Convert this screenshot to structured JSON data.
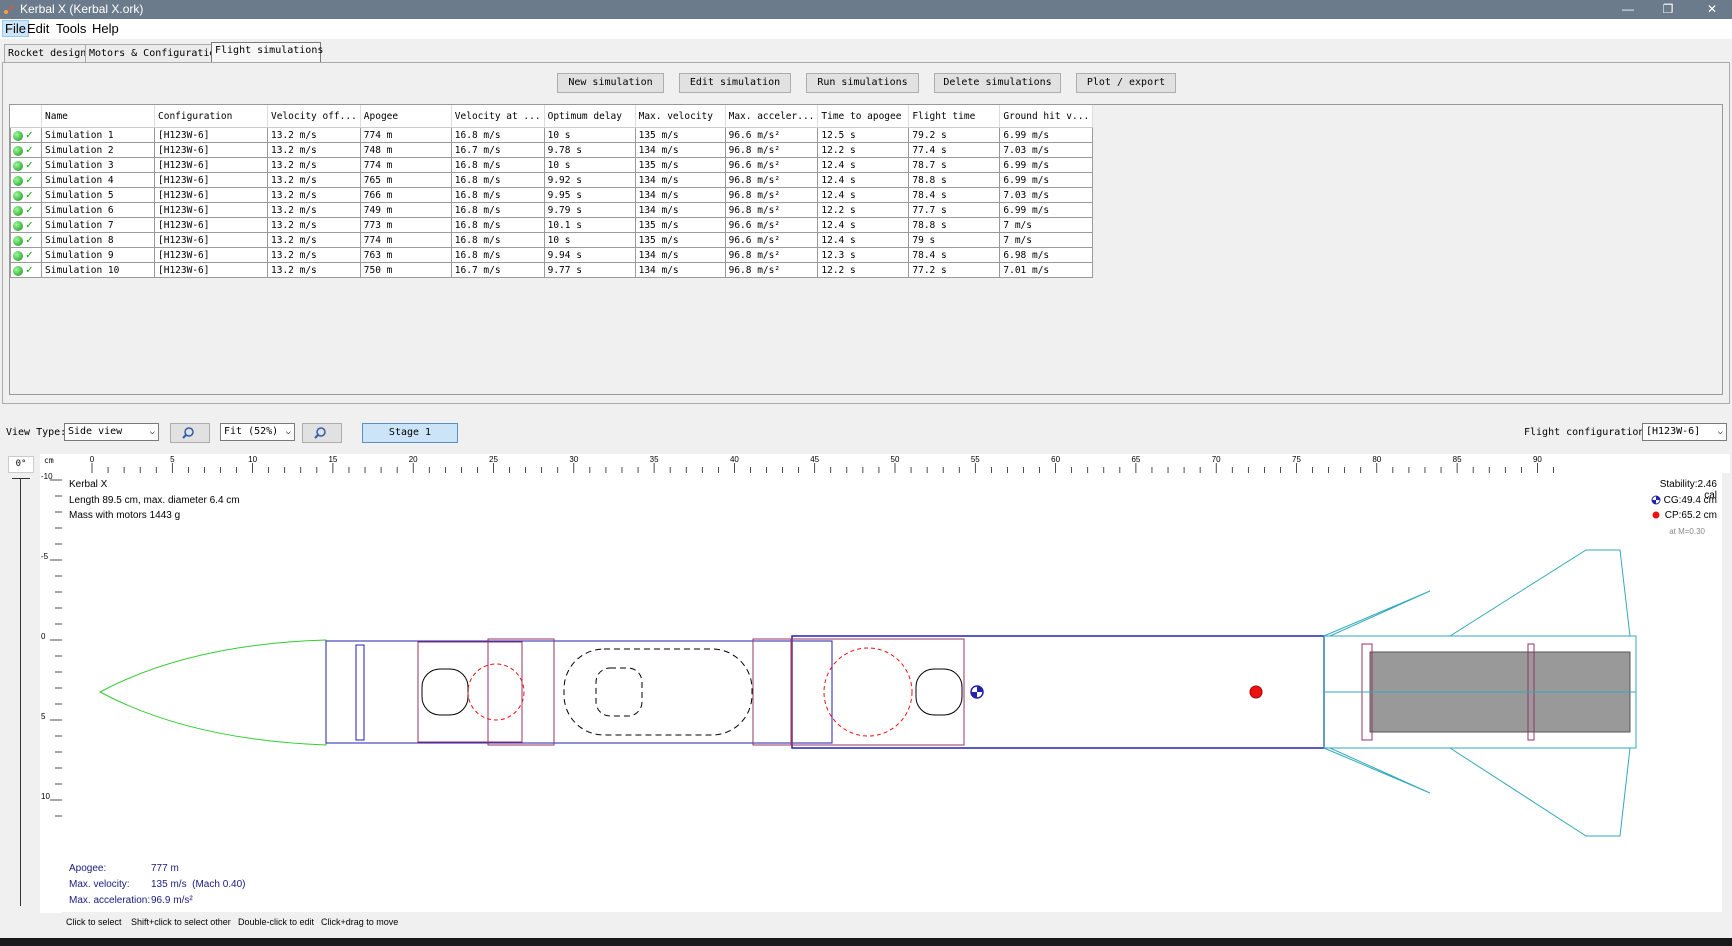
{
  "window": {
    "title": "Kerbal X (Kerbal X.ork)",
    "minimize": "—",
    "restore": "❐",
    "close": "✕"
  },
  "menu": {
    "file": "File",
    "edit": "Edit",
    "tools": "Tools",
    "help": "Help"
  },
  "tabs": {
    "rocket_design": "Rocket design",
    "motors": "Motors & Configuration",
    "flight_sims": "Flight simulations"
  },
  "buttons": {
    "new": "New simulation",
    "edit": "Edit simulation",
    "run": "Run simulations",
    "delete": "Delete simulations",
    "plot": "Plot / export"
  },
  "table": {
    "headers": [
      "Name",
      "Configuration",
      "Velocity off...",
      "Apogee",
      "Velocity at ...",
      "Optimum delay",
      "Max. velocity",
      "Max. acceler...",
      "Time to apogee",
      "Flight time",
      "Ground hit v..."
    ],
    "rows": [
      [
        "Simulation 1",
        "[H123W-6]",
        "13.2 m/s",
        "774 m",
        "16.8 m/s",
        "10 s",
        "135 m/s",
        "96.6 m/s²",
        "12.5 s",
        "79.2 s",
        "6.99 m/s"
      ],
      [
        "Simulation 2",
        "[H123W-6]",
        "13.2 m/s",
        "748 m",
        "16.7 m/s",
        "9.78 s",
        "134 m/s",
        "96.8 m/s²",
        "12.2 s",
        "77.4 s",
        "7.03 m/s"
      ],
      [
        "Simulation 3",
        "[H123W-6]",
        "13.2 m/s",
        "774 m",
        "16.8 m/s",
        "10 s",
        "135 m/s",
        "96.6 m/s²",
        "12.4 s",
        "78.7 s",
        "6.99 m/s"
      ],
      [
        "Simulation 4",
        "[H123W-6]",
        "13.2 m/s",
        "765 m",
        "16.8 m/s",
        "9.92 s",
        "134 m/s",
        "96.8 m/s²",
        "12.4 s",
        "78.8 s",
        "6.99 m/s"
      ],
      [
        "Simulation 5",
        "[H123W-6]",
        "13.2 m/s",
        "766 m",
        "16.8 m/s",
        "9.95 s",
        "134 m/s",
        "96.8 m/s²",
        "12.4 s",
        "78.4 s",
        "7.03 m/s"
      ],
      [
        "Simulation 6",
        "[H123W-6]",
        "13.2 m/s",
        "749 m",
        "16.8 m/s",
        "9.79 s",
        "134 m/s",
        "96.8 m/s²",
        "12.2 s",
        "77.7 s",
        "6.99 m/s"
      ],
      [
        "Simulation 7",
        "[H123W-6]",
        "13.2 m/s",
        "773 m",
        "16.8 m/s",
        "10.1 s",
        "135 m/s",
        "96.6 m/s²",
        "12.4 s",
        "78.8 s",
        "7 m/s"
      ],
      [
        "Simulation 8",
        "[H123W-6]",
        "13.2 m/s",
        "774 m",
        "16.8 m/s",
        "10 s",
        "135 m/s",
        "96.6 m/s²",
        "12.4 s",
        "79 s",
        "7 m/s"
      ],
      [
        "Simulation 9",
        "[H123W-6]",
        "13.2 m/s",
        "763 m",
        "16.8 m/s",
        "9.94 s",
        "134 m/s",
        "96.8 m/s²",
        "12.3 s",
        "78.4 s",
        "6.98 m/s"
      ],
      [
        "Simulation 10",
        "[H123W-6]",
        "13.2 m/s",
        "750 m",
        "16.7 m/s",
        "9.77 s",
        "134 m/s",
        "96.8 m/s²",
        "12.2 s",
        "77.2 s",
        "7.01 m/s"
      ]
    ]
  },
  "view": {
    "view_type_label": "View Type:",
    "view_type": "Side view",
    "zoom": "Fit (52%)",
    "stage": "Stage 1",
    "flight_config_label": "Flight configuration:",
    "flight_config": "[H123W-6]"
  },
  "figure": {
    "rotation": "0°",
    "unit": "cm",
    "rocket_name": "Kerbal X",
    "dims": "Length 89.5 cm, max. diameter 6.4 cm",
    "mass": "Mass with motors 1443 g",
    "stability": "Stability:2.46 cal",
    "cg": "CG:49.4 cm",
    "cp": "CP:65.2 cm",
    "mach": "at M=0.30",
    "apogee_label": "Apogee:",
    "apogee": "777 m",
    "maxv_label": "Max. velocity:",
    "maxv": "135 m/s  (Mach 0.40)",
    "maxa_label": "Max. acceleration:",
    "maxa": "96.9 m/s²",
    "ruler_x": [
      "0",
      "5",
      "10",
      "15",
      "20",
      "25",
      "30",
      "35",
      "40",
      "45",
      "50",
      "55",
      "60",
      "65",
      "70",
      "75",
      "80",
      "85",
      "90"
    ],
    "ruler_y": [
      "-10",
      "-5",
      "0",
      "5",
      "10"
    ]
  },
  "hints": {
    "click": "Click to select",
    "shift": "Shift+click to select other",
    "dbl": "Double-click to edit",
    "drag": "Click+drag to move"
  },
  "colors": {
    "nose": "#33cc33",
    "body": "#2222aa",
    "internal": "#993366",
    "fins": "#33aabb",
    "cp": "#ee1111",
    "motor": "#999999"
  }
}
